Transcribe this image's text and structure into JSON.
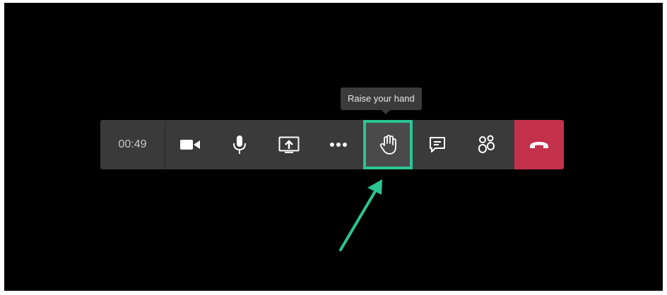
{
  "toolbar": {
    "timer": "00:49",
    "buttons": [
      {
        "name": "camera-button",
        "icon": "video-camera-icon"
      },
      {
        "name": "mic-button",
        "icon": "microphone-icon"
      },
      {
        "name": "share-screen-button",
        "icon": "share-screen-icon"
      },
      {
        "name": "more-actions-button",
        "icon": "more-icon"
      },
      {
        "name": "raise-hand-button",
        "icon": "hand-icon",
        "active": true
      },
      {
        "name": "chat-button",
        "icon": "chat-icon"
      },
      {
        "name": "participants-button",
        "icon": "participants-icon"
      },
      {
        "name": "hang-up-button",
        "icon": "phone-hangup-icon"
      }
    ]
  },
  "tooltip": {
    "text": "Raise your hand"
  },
  "colors": {
    "background": "#000000",
    "toolbar": "#3a3a3a",
    "highlight": "#2bc593",
    "hangup": "#c4314b",
    "icon": "#ffffff"
  }
}
